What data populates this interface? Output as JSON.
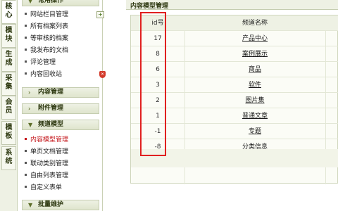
{
  "tabs": [
    {
      "label": "核心"
    },
    {
      "label": "模块"
    },
    {
      "label": "生成"
    },
    {
      "label": "采集"
    },
    {
      "label": "会员"
    },
    {
      "label": "模板"
    },
    {
      "label": "系统"
    }
  ],
  "menu": {
    "group_common": {
      "label": "常用操作"
    },
    "common_items": [
      {
        "label": "网站栏目管理"
      },
      {
        "label": "所有档案列表"
      },
      {
        "label": "等审核的档案"
      },
      {
        "label": "我发布的文档"
      },
      {
        "label": "评论管理"
      },
      {
        "label": "内容回收站"
      }
    ],
    "group_content": {
      "label": "内容管理"
    },
    "group_attachment": {
      "label": "附件管理"
    },
    "group_channel": {
      "label": "频道模型"
    },
    "channel_items": [
      {
        "label": "内容模型管理"
      },
      {
        "label": "单页文档管理"
      },
      {
        "label": "联动类别管理"
      },
      {
        "label": "自由列表管理"
      },
      {
        "label": "自定义表单"
      }
    ],
    "group_batch": {
      "label": "批量维护"
    }
  },
  "content": {
    "title": "内容模型管理",
    "table": {
      "headers": {
        "id": "id号",
        "name": "频道名称"
      },
      "rows": [
        {
          "id": "17",
          "name": "产品中心"
        },
        {
          "id": "8",
          "name": "案例展示"
        },
        {
          "id": "6",
          "name": "商品"
        },
        {
          "id": "3",
          "name": "软件"
        },
        {
          "id": "2",
          "name": "图片集"
        },
        {
          "id": "1",
          "name": "普通文章"
        },
        {
          "id": "-1",
          "name": "专题"
        },
        {
          "id": "-8",
          "name": "分类信息"
        }
      ]
    }
  },
  "colors": {
    "highlight": "#e02020",
    "active_menu": "#c4171b",
    "panel": "#eef1e4"
  }
}
